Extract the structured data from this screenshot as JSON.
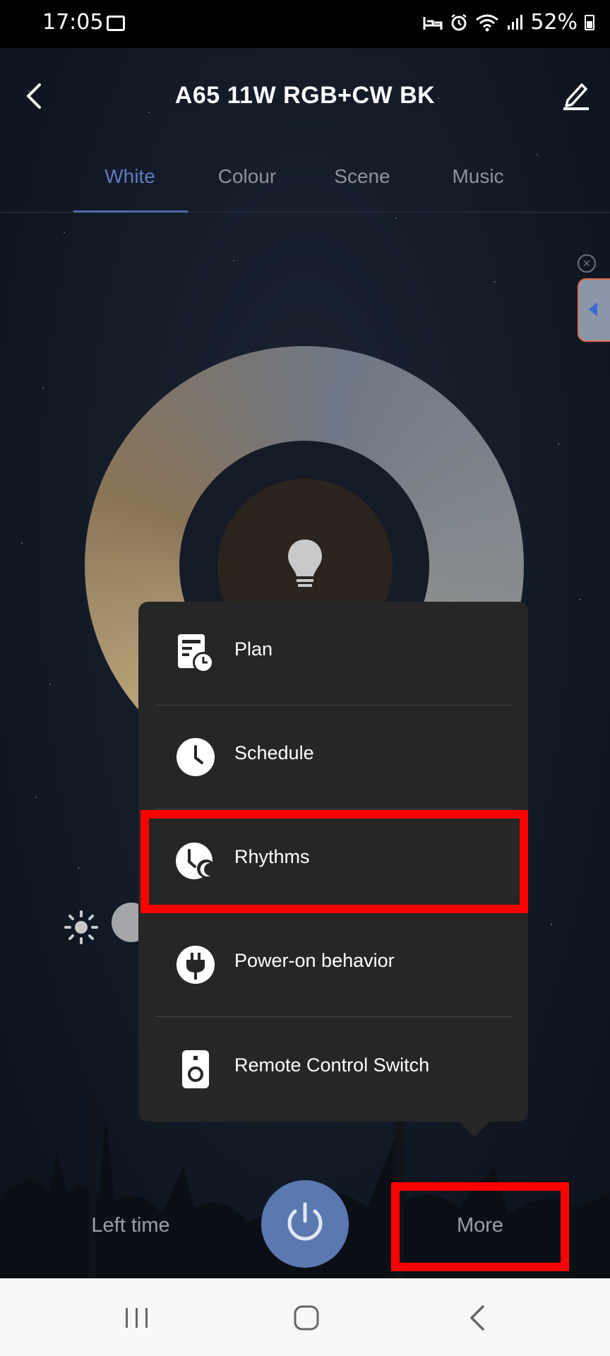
{
  "status_bar": {
    "time": "17:05",
    "battery": "52%"
  },
  "header": {
    "title": "A65 11W RGB+CW BK"
  },
  "tabs": [
    {
      "label": "White",
      "active": true
    },
    {
      "label": "Colour",
      "active": false
    },
    {
      "label": "Scene",
      "active": false
    },
    {
      "label": "Music",
      "active": false
    }
  ],
  "menu": {
    "items": [
      {
        "label": "Plan",
        "icon": "plan-icon"
      },
      {
        "label": "Schedule",
        "icon": "clock-icon"
      },
      {
        "label": "Rhythms",
        "icon": "rhythms-icon"
      },
      {
        "label": "Power-on behavior",
        "icon": "plug-icon"
      },
      {
        "label": "Remote Control Switch",
        "icon": "remote-icon"
      }
    ]
  },
  "bottom_bar": {
    "left_time_label": "Left time",
    "more_label": "More"
  },
  "colors": {
    "accent": "#5e7cc0",
    "power_button": "#5b78b0",
    "highlight": "#ff0000",
    "menu_bg": "#262626"
  }
}
